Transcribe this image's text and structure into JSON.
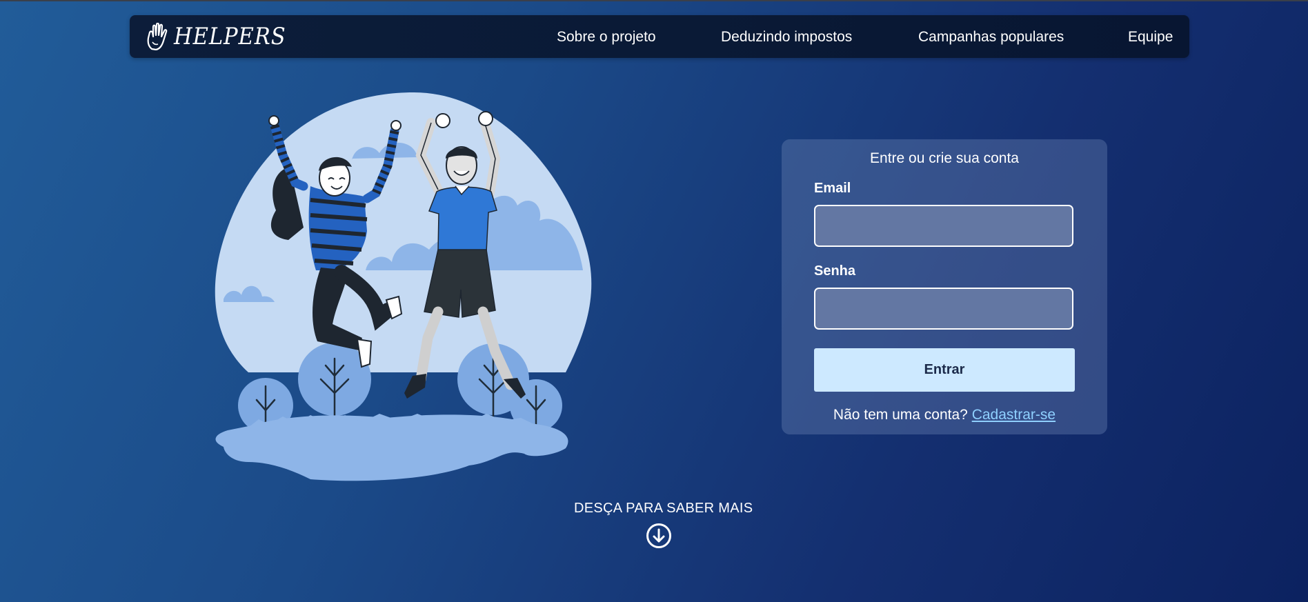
{
  "brand": {
    "name": "HELPERS",
    "icon": "hand-icon"
  },
  "nav": {
    "items": [
      {
        "label": "Sobre o projeto"
      },
      {
        "label": "Deduzindo impostos"
      },
      {
        "label": "Campanhas populares"
      },
      {
        "label": "Equipe"
      }
    ]
  },
  "login": {
    "title": "Entre ou crie sua conta",
    "email_label": "Email",
    "email_value": "",
    "password_label": "Senha",
    "password_value": "",
    "submit_label": "Entrar",
    "signup_prompt": "Não tem uma conta?",
    "signup_link": "Cadastrar-se"
  },
  "scroll": {
    "text": "DESÇA PARA SABER MAIS",
    "icon": "arrow-down-circle-icon"
  },
  "illustration": {
    "subject": "two-people-jumping-illustration"
  },
  "colors": {
    "background_start": "#215c99",
    "background_end": "#0c2260",
    "navbar": "#0a1a36",
    "button": "#cde9ff",
    "link": "#8fd0ff",
    "input": "#6377a3"
  }
}
